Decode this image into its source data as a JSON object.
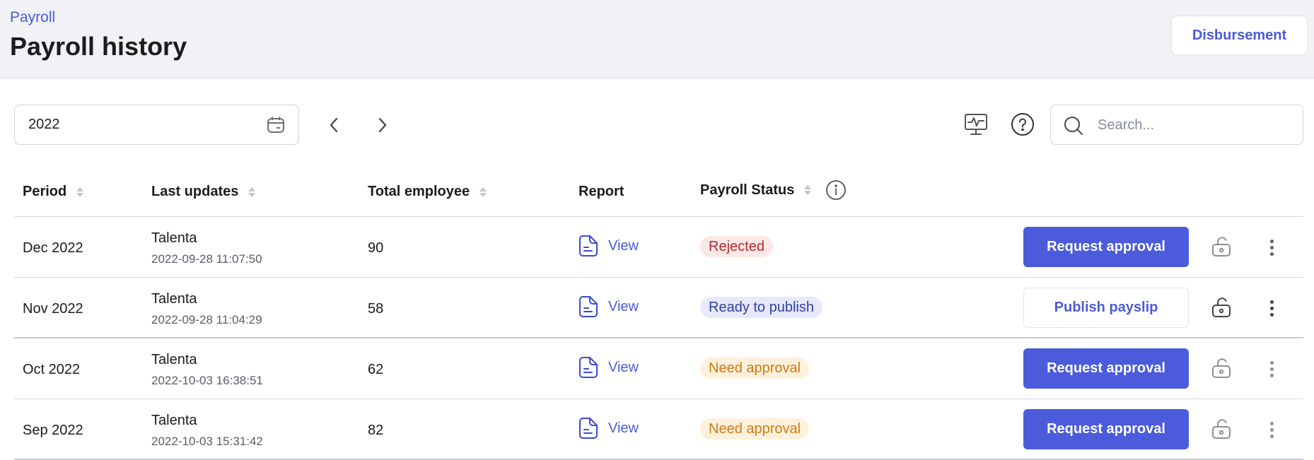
{
  "header": {
    "breadcrumb": "Payroll",
    "title": "Payroll history",
    "disbursement_label": "Disbursement"
  },
  "filters": {
    "year": "2022",
    "search_placeholder": "Search..."
  },
  "table": {
    "columns": {
      "period": "Period",
      "last_updates": "Last updates",
      "total_employee": "Total employee",
      "report": "Report",
      "payroll_status": "Payroll Status"
    },
    "rows": [
      {
        "period": "Dec 2022",
        "updated_by": "Talenta",
        "updated_at": "2022-09-28 11:07:50",
        "total_employee": "90",
        "report_label": "View",
        "status": "Rejected",
        "status_type": "rejected",
        "action": "Request approval",
        "action_type": "primary"
      },
      {
        "period": "Nov 2022",
        "updated_by": "Talenta",
        "updated_at": "2022-09-28 11:04:29",
        "total_employee": "58",
        "report_label": "View",
        "status": "Ready to publish",
        "status_type": "ready",
        "action": "Publish payslip",
        "action_type": "secondary"
      },
      {
        "period": "Oct 2022",
        "updated_by": "Talenta",
        "updated_at": "2022-10-03 16:38:51",
        "total_employee": "62",
        "report_label": "View",
        "status": "Need approval",
        "status_type": "need",
        "action": "Request approval",
        "action_type": "primary"
      },
      {
        "period": "Sep 2022",
        "updated_by": "Talenta",
        "updated_at": "2022-10-03 15:31:42",
        "total_employee": "82",
        "report_label": "View",
        "status": "Need approval",
        "status_type": "need",
        "action": "Request approval",
        "action_type": "primary"
      }
    ]
  },
  "icons": {
    "calendar": "calendar-icon",
    "prev": "chevron-left-icon",
    "next": "chevron-right-icon",
    "monitor": "monitor-icon",
    "help": "help-circle-icon",
    "search": "search-icon",
    "info": "info-icon",
    "report": "document-icon",
    "lock": "unlock-icon",
    "more": "more-vertical-icon"
  },
  "colors": {
    "accent": "#4b5bdc",
    "header_bg": "#f1f2f6",
    "rejected": "#b42b2b",
    "ready": "#2f3fa8",
    "need_approval": "#d17a12"
  }
}
